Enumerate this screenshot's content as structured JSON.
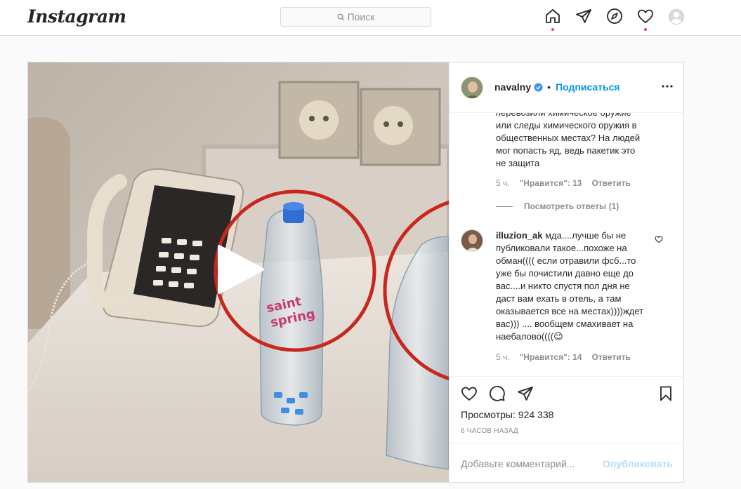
{
  "nav": {
    "logo": "Instagram",
    "search_placeholder": "Поиск",
    "icons": [
      "home-icon",
      "direct-icon",
      "explore-icon",
      "activity-icon",
      "profile-avatar"
    ]
  },
  "post": {
    "username": "navalny",
    "separator": "•",
    "follow_label": "Подписаться",
    "comments": [
      {
        "text": "перевозили химическое оружие или следы химического оружия в общественных местах? На людей мог попасть яд, ведь пакетик это не защита",
        "time": "5 ч.",
        "likes": "\"Нравится\": 13",
        "reply": "Ответить",
        "view_replies": "Посмотреть ответы (1)"
      },
      {
        "username": "illuzion_ak",
        "text": "мда....лучше бы не публиковали такое...похоже на обман(((( если отравили фсб...то уже бы почистили давно еще до вас....и никто спустя пол дня не даст вам ехать в отель, а там оказывается все на местах))))ждет вас))) .... вообщем смахивает на наебалово((((😉",
        "time": "5 ч.",
        "likes": "\"Нравится\": 14",
        "reply": "Ответить"
      }
    ],
    "views_label": "Просмотры:",
    "views_value": "924 338",
    "posted_ago": "6 ЧАСОВ НАЗАД",
    "add_comment_placeholder": "Добавьте комментарий...",
    "publish_label": "Опубликовать"
  },
  "colors": {
    "accent": "#0095f6",
    "notification_dot": "#ed4956",
    "annotation_circle": "#c8271e",
    "muted_text": "#8e8e8e"
  }
}
